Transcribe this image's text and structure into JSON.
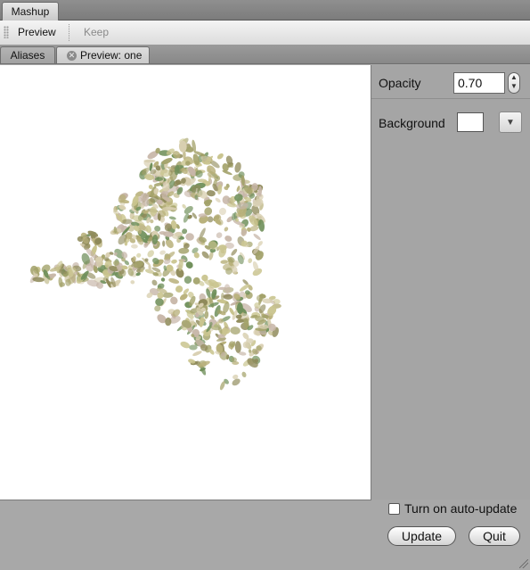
{
  "window": {
    "title_tab": "Mashup"
  },
  "toolbar": {
    "preview_label": "Preview",
    "keep_label": "Keep"
  },
  "tabs": {
    "aliases_label": "Aliases",
    "preview_label": "Preview: one"
  },
  "panel": {
    "opacity_label": "Opacity",
    "opacity_value": "0.70",
    "background_label": "Background",
    "background_color": "#ffffff"
  },
  "footer": {
    "auto_update_label": "Turn on auto-update",
    "auto_update_checked": false,
    "update_label": "Update",
    "quit_label": "Quit"
  },
  "render": {
    "description_colors": [
      "#c9c48e",
      "#b8b07a",
      "#8f8a5a",
      "#d8cfb0",
      "#a3a26a",
      "#6f8f5a",
      "#c7b6a8"
    ]
  }
}
